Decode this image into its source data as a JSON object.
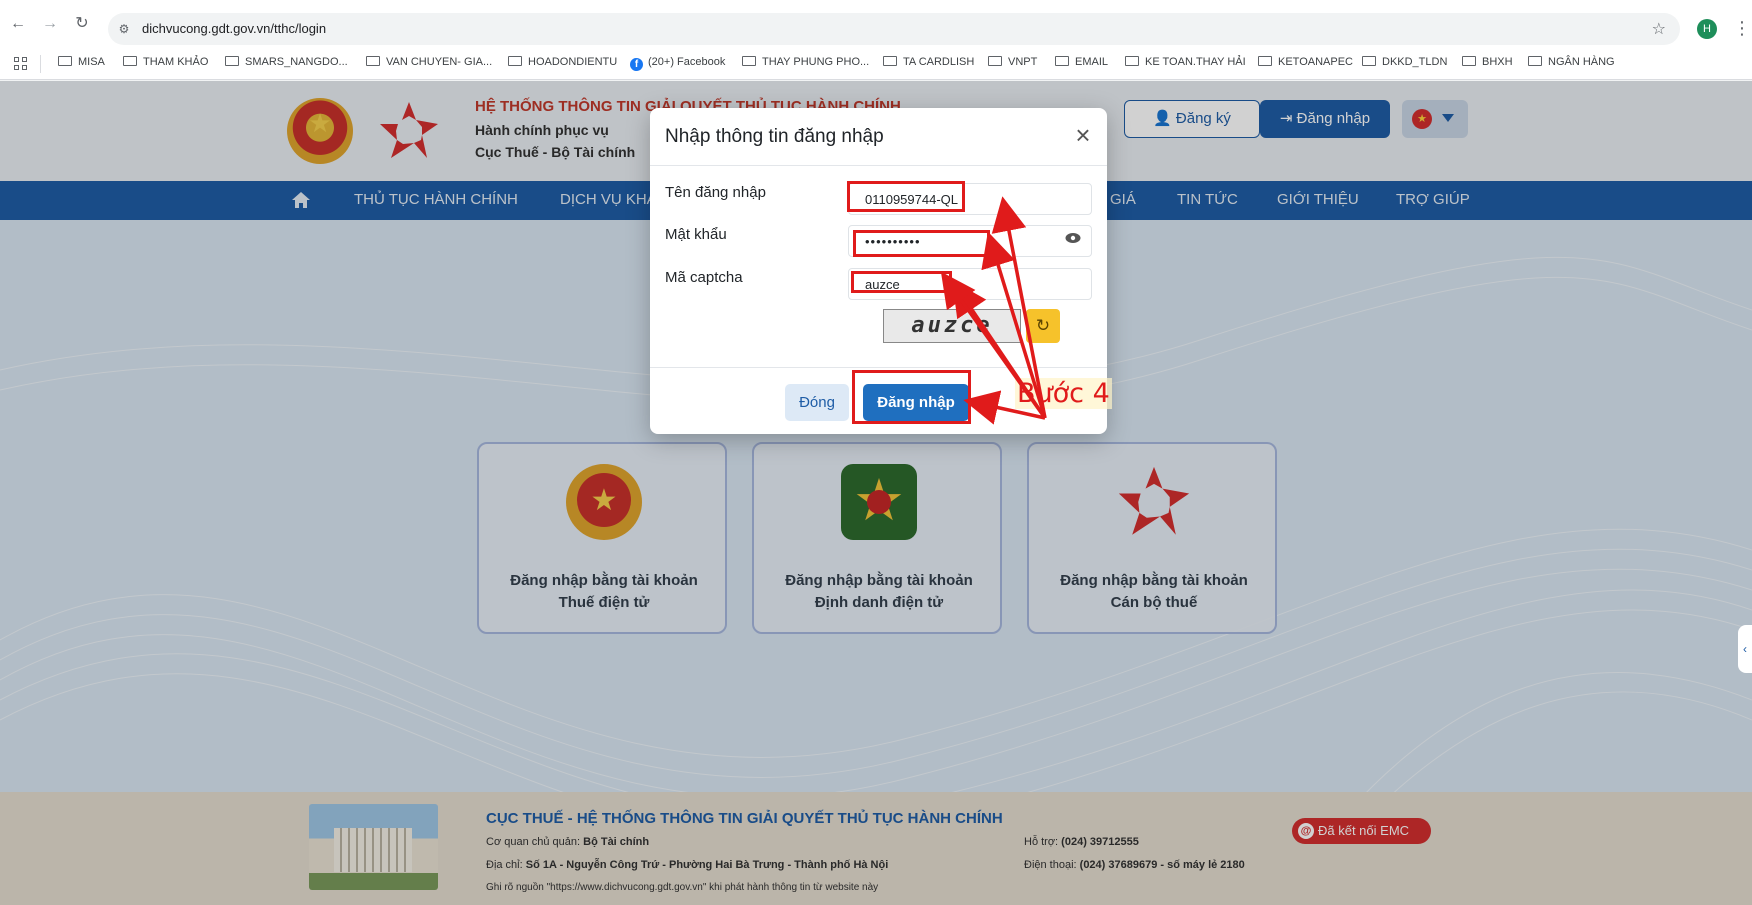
{
  "browser": {
    "url": "dichvucong.gdt.gov.vn/tthc/login",
    "profile_initial": "H",
    "bookmarks": [
      "MISA",
      "THAM KHẢO",
      "SMARS_NANGDO...",
      "VAN CHUYEN- GIA...",
      "HOADONDIENTU",
      "(20+) Facebook",
      "THAY PHUNG PHO...",
      "TA CARDLISH",
      "VNPT",
      "EMAIL",
      "KE TOAN.THAY HẢI",
      "KETOANAPEC",
      "DKKD_TLDN",
      "BHXH",
      "NGÂN HÀNG"
    ]
  },
  "header": {
    "title": "HỆ THỐNG THÔNG TIN GIẢI QUYẾT THỦ TỤC HÀNH CHÍNH",
    "subtitle_1": "Hành chính phục vụ",
    "subtitle_2": "Cục Thuế - Bộ Tài chính",
    "register_label": "Đăng ký",
    "login_label": "Đăng nhập"
  },
  "nav": {
    "items": [
      "THỦ TỤC HÀNH CHÍNH",
      "DỊCH VỤ KHÁC",
      "GIÁ",
      "TIN TỨC",
      "GIỚI THIỆU",
      "TRỢ GIÚP"
    ]
  },
  "cards": [
    {
      "line1": "Đăng nhập bằng tài khoản",
      "line2": "Thuế điện tử"
    },
    {
      "line1": "Đăng nhập bằng tài khoản",
      "line2": "Định danh điện tử"
    },
    {
      "line1": "Đăng nhập bằng tài khoản",
      "line2": "Cán bộ thuế"
    }
  ],
  "footer": {
    "title": "CỤC THUẾ - HỆ THỐNG THÔNG TIN GIẢI QUYẾT THỦ TỤC HÀNH CHÍNH",
    "owner_label": "Cơ quan chủ quản:",
    "owner": "Bộ Tài chính",
    "address_label": "Địa chỉ:",
    "address": "Số 1A - Nguyễn Công Trứ - Phường Hai Bà Trưng - Thành phố Hà Nội",
    "source_note": "Ghi rõ nguồn \"https://www.dichvucong.gdt.gov.vn\" khi phát hành thông tin từ website này",
    "support_label": "Hỗ trợ:",
    "support": "(024) 39712555",
    "phone_label": "Điện thoại:",
    "phone": "(024) 37689679 - số máy lẻ 2180",
    "emc_badge": "Đã kết nối EMC"
  },
  "modal": {
    "title": "Nhập thông tin đăng nhập",
    "username_label": "Tên đăng nhập",
    "username_value": "0110959744-QL",
    "password_label": "Mật khẩu",
    "password_value": "••••••••••",
    "captcha_label": "Mã captcha",
    "captcha_value": "auzce",
    "captcha_image_text": "auzce",
    "close_label": "Đóng",
    "submit_label": "Đăng nhập"
  },
  "annotation": {
    "step_label": "Bước 4",
    "color": "#e01b1b"
  },
  "colors": {
    "primary": "#1f5da6",
    "title_red": "#c0392b"
  }
}
